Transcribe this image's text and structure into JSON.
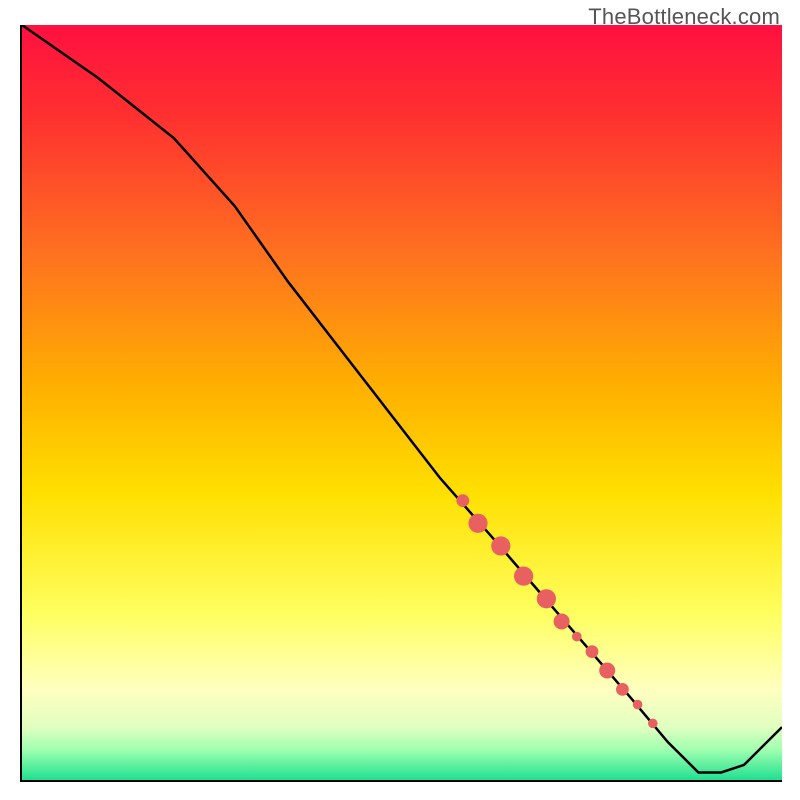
{
  "watermark": "TheBottleneck.com",
  "chart_data": {
    "type": "line",
    "title": "",
    "xlabel": "",
    "ylabel": "",
    "xlim": [
      0,
      100
    ],
    "ylim": [
      0,
      100
    ],
    "grid": false,
    "gradient_stops": [
      {
        "offset": 0.0,
        "color": "#ff1040"
      },
      {
        "offset": 0.12,
        "color": "#ff3030"
      },
      {
        "offset": 0.3,
        "color": "#ff7020"
      },
      {
        "offset": 0.48,
        "color": "#ffb000"
      },
      {
        "offset": 0.62,
        "color": "#ffe000"
      },
      {
        "offset": 0.78,
        "color": "#ffff60"
      },
      {
        "offset": 0.88,
        "color": "#ffffc0"
      },
      {
        "offset": 0.93,
        "color": "#e0ffc0"
      },
      {
        "offset": 0.96,
        "color": "#a0ffb0"
      },
      {
        "offset": 1.0,
        "color": "#20e090"
      }
    ],
    "series": [
      {
        "name": "bottleneck-curve",
        "color": "#000000",
        "x": [
          0,
          10,
          20,
          28,
          35,
          45,
          55,
          62,
          68,
          74,
          80,
          85,
          89,
          92,
          95,
          100
        ],
        "y": [
          100,
          93,
          85,
          76,
          66,
          53,
          40,
          32,
          25,
          18,
          11,
          5,
          1,
          1,
          2,
          7
        ]
      }
    ],
    "markers": {
      "name": "highlight-segment",
      "color": "#e86060",
      "points": [
        {
          "x": 58,
          "y": 37,
          "r": 4
        },
        {
          "x": 60,
          "y": 34,
          "r": 6
        },
        {
          "x": 63,
          "y": 31,
          "r": 6
        },
        {
          "x": 66,
          "y": 27,
          "r": 6
        },
        {
          "x": 69,
          "y": 24,
          "r": 6
        },
        {
          "x": 71,
          "y": 21,
          "r": 5
        },
        {
          "x": 73,
          "y": 19,
          "r": 3
        },
        {
          "x": 75,
          "y": 17,
          "r": 4
        },
        {
          "x": 77,
          "y": 14.5,
          "r": 5
        },
        {
          "x": 79,
          "y": 12,
          "r": 4
        },
        {
          "x": 81,
          "y": 10,
          "r": 3
        },
        {
          "x": 83,
          "y": 7.5,
          "r": 3
        }
      ]
    }
  }
}
